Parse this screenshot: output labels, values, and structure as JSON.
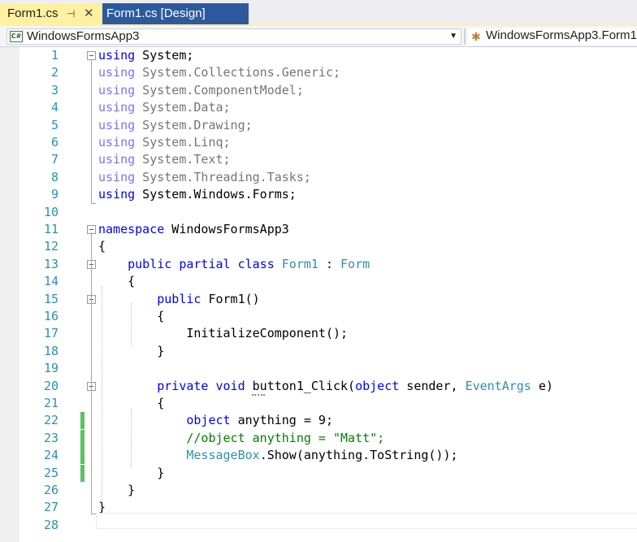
{
  "tabs": {
    "active": {
      "label": "Form1.cs",
      "pin_glyph": "⊣",
      "close_glyph": "✕"
    },
    "design": {
      "label": "Form1.cs [Design]"
    }
  },
  "navbar": {
    "project_icon": "C#",
    "project": "WindowsFormsApp3",
    "dropdown_glyph": "▼",
    "class_icon_glyph": "✱",
    "class": "WindowsFormsApp3.Form1"
  },
  "editor": {
    "lines": [
      {
        "num": "1",
        "code": "",
        "tokens": [
          {
            "text": "using",
            "cls": "k"
          },
          {
            "text": " System;",
            "cls": ""
          }
        ],
        "dim": false
      },
      {
        "num": "2",
        "code": "",
        "tokens": [
          {
            "text": "using",
            "cls": "k"
          },
          {
            "text": " System.Collections.Generic;",
            "cls": ""
          }
        ],
        "dim": true
      },
      {
        "num": "3",
        "code": "",
        "tokens": [
          {
            "text": "using",
            "cls": "k"
          },
          {
            "text": " System.ComponentModel;",
            "cls": ""
          }
        ],
        "dim": true
      },
      {
        "num": "4",
        "code": "",
        "tokens": [
          {
            "text": "using",
            "cls": "k"
          },
          {
            "text": " System.Data;",
            "cls": ""
          }
        ],
        "dim": true
      },
      {
        "num": "5",
        "code": "",
        "tokens": [
          {
            "text": "using",
            "cls": "k"
          },
          {
            "text": " System.Drawing;",
            "cls": ""
          }
        ],
        "dim": true
      },
      {
        "num": "6",
        "code": "",
        "tokens": [
          {
            "text": "using",
            "cls": "k"
          },
          {
            "text": " System.Linq;",
            "cls": ""
          }
        ],
        "dim": true
      },
      {
        "num": "7",
        "code": "",
        "tokens": [
          {
            "text": "using",
            "cls": "k"
          },
          {
            "text": " System.Text;",
            "cls": ""
          }
        ],
        "dim": true
      },
      {
        "num": "8",
        "code": "",
        "tokens": [
          {
            "text": "using",
            "cls": "k"
          },
          {
            "text": " System.Threading.Tasks;",
            "cls": ""
          }
        ],
        "dim": true
      },
      {
        "num": "9",
        "code": "",
        "tokens": [
          {
            "text": "using",
            "cls": "k"
          },
          {
            "text": " System.Windows.Forms;",
            "cls": ""
          }
        ],
        "dim": false
      },
      {
        "num": "10",
        "code": "",
        "tokens": [],
        "dim": false
      },
      {
        "num": "11",
        "code": "",
        "tokens": [
          {
            "text": "namespace",
            "cls": "k"
          },
          {
            "text": " WindowsFormsApp3",
            "cls": ""
          }
        ],
        "dim": false
      },
      {
        "num": "12",
        "code": "",
        "tokens": [
          {
            "text": "{",
            "cls": ""
          }
        ],
        "dim": false
      },
      {
        "num": "13",
        "code": "",
        "tokens": [
          {
            "text": "    ",
            "cls": ""
          },
          {
            "text": "public",
            "cls": "k"
          },
          {
            "text": " ",
            "cls": ""
          },
          {
            "text": "partial",
            "cls": "k"
          },
          {
            "text": " ",
            "cls": ""
          },
          {
            "text": "class",
            "cls": "k"
          },
          {
            "text": " ",
            "cls": ""
          },
          {
            "text": "Form1",
            "cls": "t"
          },
          {
            "text": " : ",
            "cls": ""
          },
          {
            "text": "Form",
            "cls": "t"
          }
        ],
        "dim": false
      },
      {
        "num": "14",
        "code": "",
        "tokens": [
          {
            "text": "    {",
            "cls": ""
          }
        ],
        "dim": false
      },
      {
        "num": "15",
        "code": "",
        "tokens": [
          {
            "text": "        ",
            "cls": ""
          },
          {
            "text": "public",
            "cls": "k"
          },
          {
            "text": " Form1()",
            "cls": ""
          }
        ],
        "dim": false
      },
      {
        "num": "16",
        "code": "",
        "tokens": [
          {
            "text": "        {",
            "cls": ""
          }
        ],
        "dim": false
      },
      {
        "num": "17",
        "code": "",
        "tokens": [
          {
            "text": "            InitializeComponent();",
            "cls": ""
          }
        ],
        "dim": false
      },
      {
        "num": "18",
        "code": "",
        "tokens": [
          {
            "text": "        }",
            "cls": ""
          }
        ],
        "dim": false
      },
      {
        "num": "19",
        "code": "",
        "tokens": [],
        "dim": false
      },
      {
        "num": "20",
        "code": "",
        "tokens": [
          {
            "text": "        ",
            "cls": ""
          },
          {
            "text": "private",
            "cls": "k"
          },
          {
            "text": " ",
            "cls": ""
          },
          {
            "text": "void",
            "cls": "k"
          },
          {
            "text": " button1_Click(",
            "cls": ""
          },
          {
            "text": "object",
            "cls": "k"
          },
          {
            "text": " sender, ",
            "cls": ""
          },
          {
            "text": "EventArgs",
            "cls": "t"
          },
          {
            "text": " e)",
            "cls": ""
          }
        ],
        "dim": false
      },
      {
        "num": "21",
        "code": "",
        "tokens": [
          {
            "text": "        {",
            "cls": ""
          }
        ],
        "dim": false
      },
      {
        "num": "22",
        "code": "",
        "tokens": [
          {
            "text": "            ",
            "cls": ""
          },
          {
            "text": "object",
            "cls": "k"
          },
          {
            "text": " anything = 9;",
            "cls": ""
          }
        ],
        "dim": false
      },
      {
        "num": "23",
        "code": "",
        "tokens": [
          {
            "text": "            ",
            "cls": ""
          },
          {
            "text": "//object anything = \"Matt\";",
            "cls": "c"
          }
        ],
        "dim": false
      },
      {
        "num": "24",
        "code": "",
        "tokens": [
          {
            "text": "            ",
            "cls": ""
          },
          {
            "text": "MessageBox",
            "cls": "t"
          },
          {
            "text": ".Show(anything.ToString());",
            "cls": ""
          }
        ],
        "dim": false
      },
      {
        "num": "25",
        "code": "",
        "tokens": [
          {
            "text": "        }",
            "cls": ""
          }
        ],
        "dim": false
      },
      {
        "num": "26",
        "code": "",
        "tokens": [
          {
            "text": "    }",
            "cls": ""
          }
        ],
        "dim": false
      },
      {
        "num": "27",
        "code": "",
        "tokens": [
          {
            "text": "}",
            "cls": ""
          }
        ],
        "dim": false
      },
      {
        "num": "28",
        "code": "",
        "tokens": [],
        "dim": false
      }
    ]
  }
}
